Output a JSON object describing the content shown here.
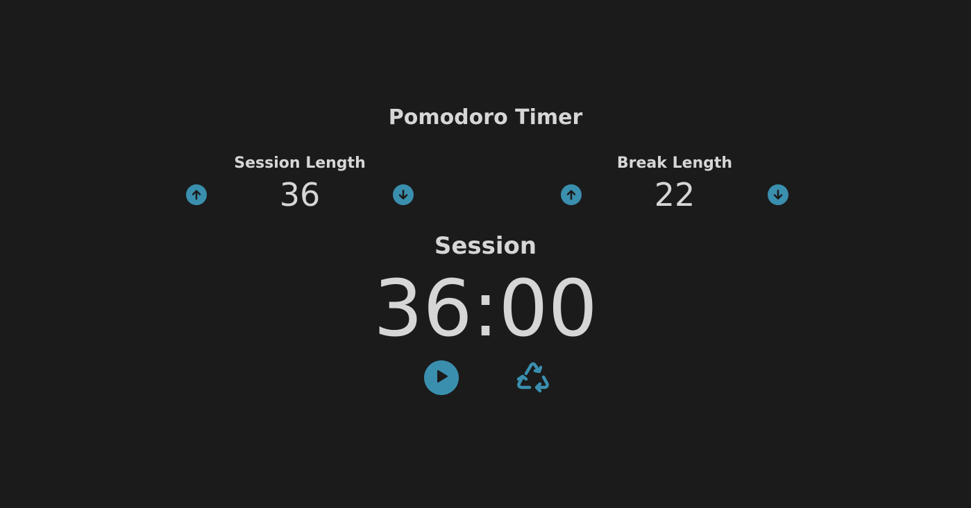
{
  "app": {
    "title": "Pomodoro Timer"
  },
  "session": {
    "label": "Session Length",
    "value": "36"
  },
  "break": {
    "label": "Break Length",
    "value": "22"
  },
  "timer": {
    "label": "Session",
    "time": "36:00"
  },
  "icons": {
    "increment": "arrow-up-circle",
    "decrement": "arrow-down-circle",
    "start": "play-circle",
    "reset": "recycle"
  },
  "colors": {
    "background": "#1b1b1b",
    "text": "#d6d6d6",
    "accent": "#3a8fae"
  }
}
